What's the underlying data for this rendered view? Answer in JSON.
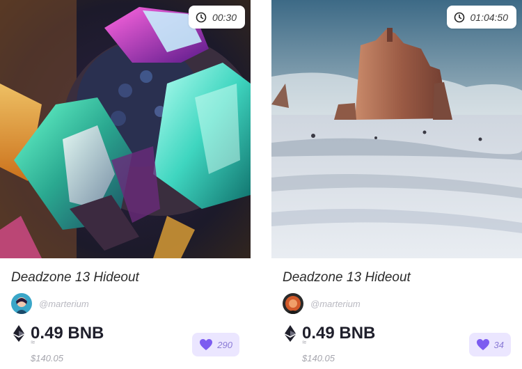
{
  "cards": [
    {
      "image": "crystal-geode-artwork",
      "timer": "00:30",
      "title": "Deadzone 13 Hideout",
      "creator": "@marterium",
      "price": "0.49 BNB",
      "approx": "≈",
      "usd": "$140.05",
      "likes": "290",
      "icons": {
        "timer": "clock-icon",
        "currency": "ethereum-icon",
        "like": "heart-icon"
      }
    },
    {
      "image": "desert-mesa-snow-artwork",
      "timer": "01:04:50",
      "title": "Deadzone 13 Hideout",
      "creator": "@marterium",
      "price": "0.49 BNB",
      "approx": "≈",
      "usd": "$140.05",
      "likes": "34",
      "icons": {
        "timer": "clock-icon",
        "currency": "ethereum-icon",
        "like": "heart-icon"
      }
    }
  ],
  "colors": {
    "accent": "#7c5cf0",
    "like_bg": "#ebe6ff",
    "text": "#1f1f2b",
    "muted": "#a6a6ae"
  }
}
